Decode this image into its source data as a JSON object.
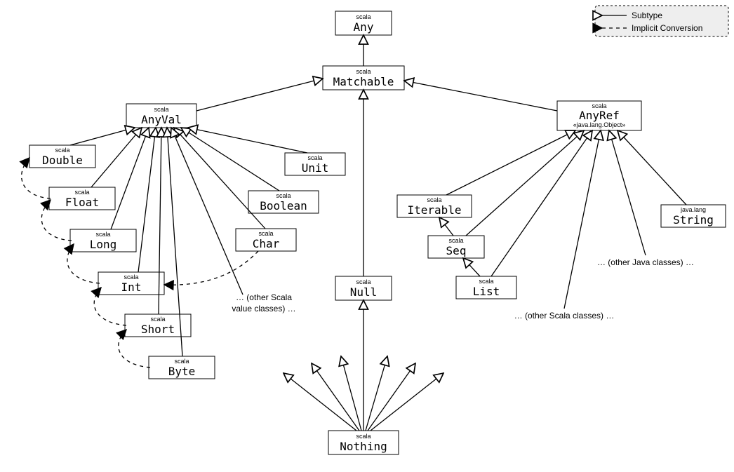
{
  "legend": {
    "subtype": "Subtype",
    "implicit": "Implicit Conversion"
  },
  "nodes": {
    "any": {
      "pkg": "scala",
      "name": "Any"
    },
    "matchable": {
      "pkg": "scala",
      "name": "Matchable"
    },
    "anyval": {
      "pkg": "scala",
      "name": "AnyVal"
    },
    "anyref": {
      "pkg": "scala",
      "name": "AnyRef",
      "stereo": "«java.lang.Object»"
    },
    "double": {
      "pkg": "scala",
      "name": "Double"
    },
    "float": {
      "pkg": "scala",
      "name": "Float"
    },
    "long": {
      "pkg": "scala",
      "name": "Long"
    },
    "int": {
      "pkg": "scala",
      "name": "Int"
    },
    "short": {
      "pkg": "scala",
      "name": "Short"
    },
    "byte": {
      "pkg": "scala",
      "name": "Byte"
    },
    "char": {
      "pkg": "scala",
      "name": "Char"
    },
    "boolean": {
      "pkg": "scala",
      "name": "Boolean"
    },
    "unit": {
      "pkg": "scala",
      "name": "Unit"
    },
    "null": {
      "pkg": "scala",
      "name": "Null"
    },
    "nothing": {
      "pkg": "scala",
      "name": "Nothing"
    },
    "iterable": {
      "pkg": "scala",
      "name": "Iterable"
    },
    "seq": {
      "pkg": "scala",
      "name": "Seq"
    },
    "list": {
      "pkg": "scala",
      "name": "List"
    },
    "string": {
      "pkg": "java.lang",
      "name": "String"
    }
  },
  "notes": {
    "otherScalaVal1": "… (other Scala",
    "otherScalaVal2": "value classes) …",
    "otherScalaCls": "… (other Scala classes) …",
    "otherJavaCls": "… (other Java classes) …"
  }
}
